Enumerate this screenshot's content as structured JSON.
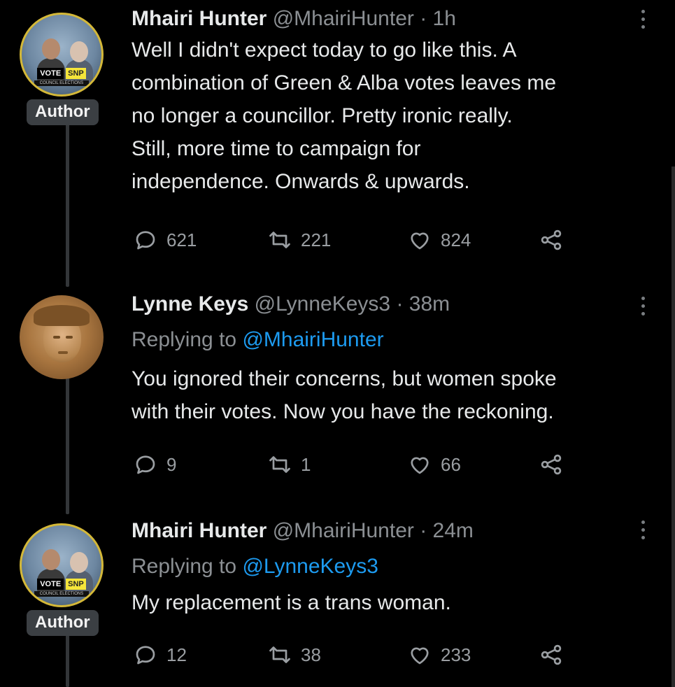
{
  "tweets": [
    {
      "name": "Mhairi Hunter",
      "handle": "@MhairiHunter",
      "time": "· 1h",
      "badge": "Author",
      "avatar_text": {
        "vote": "VOTE",
        "snp": "SNP",
        "strip": "COUNCIL ELECTIONS"
      },
      "replying_to": null,
      "text_lines": [
        "Well I didn't expect today to go like this. A",
        "combination of Green & Alba votes leaves me",
        "no longer a councillor.  Pretty ironic really.",
        "Still, more time to campaign for",
        "independence. Onwards & upwards."
      ],
      "replies": "621",
      "retweets": "221",
      "likes": "824"
    },
    {
      "name": "Lynne Keys",
      "handle": "@LynneKeys3",
      "time": "· 38m",
      "badge": null,
      "replying_prefix": "Replying to",
      "replying_to": "@MhairiHunter",
      "text_lines": [
        "You ignored their concerns, but women spoke",
        "with their votes. Now you have the reckoning."
      ],
      "replies": "9",
      "retweets": "1",
      "likes": "66"
    },
    {
      "name": "Mhairi Hunter",
      "handle": "@MhairiHunter",
      "time": "· 24m",
      "badge": "Author",
      "avatar_text": {
        "vote": "VOTE",
        "snp": "SNP",
        "strip": "COUNCIL ELECTIONS"
      },
      "replying_prefix": "Replying to",
      "replying_to": "@LynneKeys3",
      "text_lines": [
        "My replacement is a trans woman."
      ],
      "replies": "12",
      "retweets": "38",
      "likes": "233"
    }
  ],
  "icons": {
    "reply": "reply-bubble-icon",
    "retweet": "retweet-icon",
    "like": "heart-icon",
    "share": "share-icon",
    "more": "more-options-icon"
  },
  "colors": {
    "background": "#000000",
    "text": "#e7e9ea",
    "muted": "#8b8f93",
    "link": "#1d9bf0",
    "badge_bg": "#3b3f43"
  }
}
